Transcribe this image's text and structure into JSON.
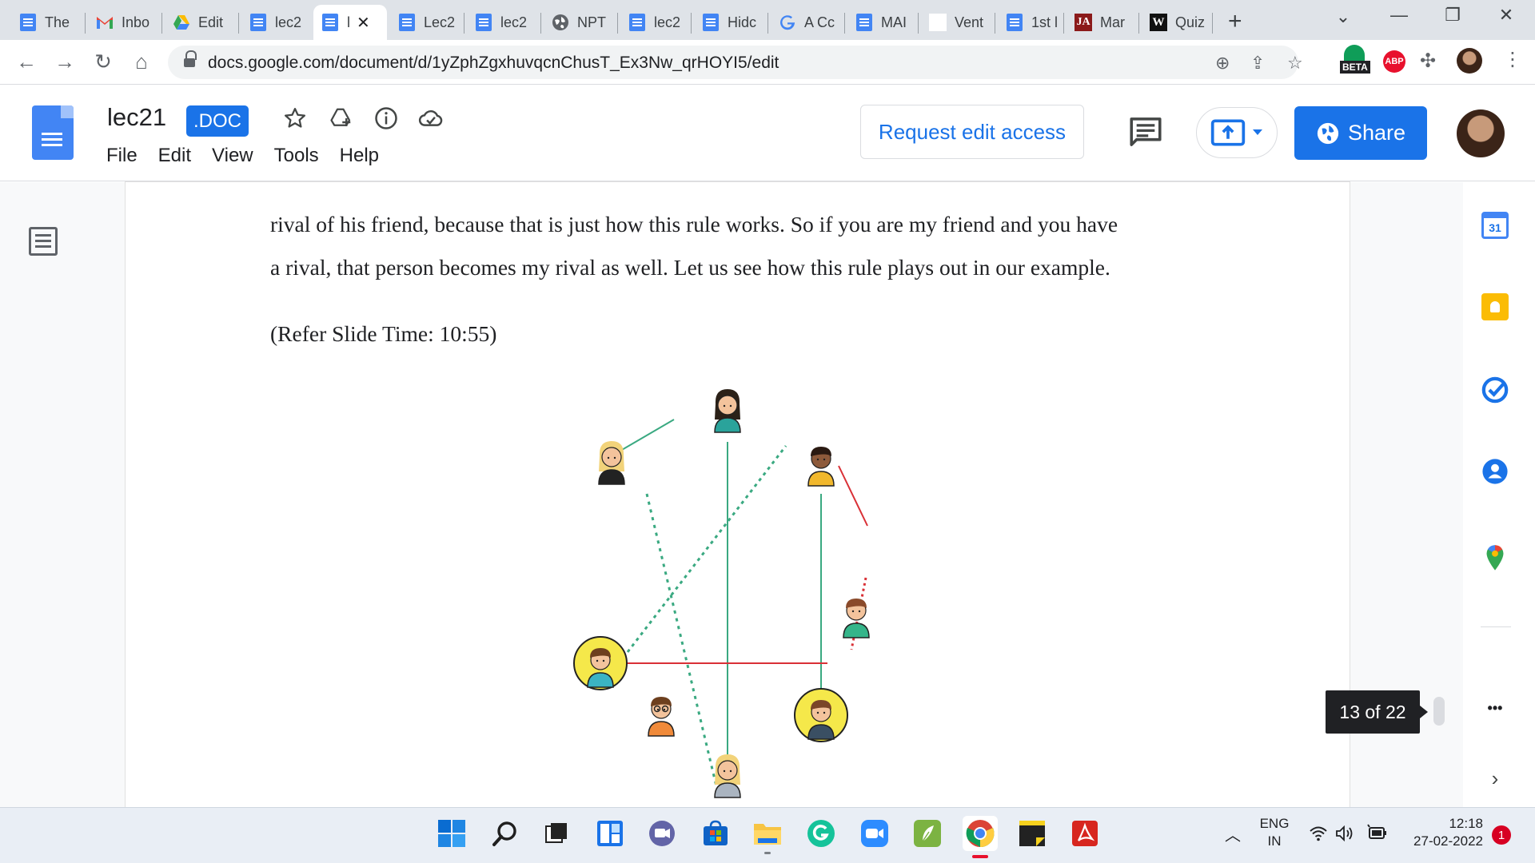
{
  "browser": {
    "tabs": [
      {
        "label": "The",
        "icon": "docs-icon"
      },
      {
        "label": "Inbo",
        "icon": "gmail-icon"
      },
      {
        "label": "Edit",
        "icon": "drive-icon"
      },
      {
        "label": "lec2",
        "icon": "docs-icon"
      },
      {
        "label": "l",
        "icon": "docs-icon",
        "active": true
      },
      {
        "label": "Lec2",
        "icon": "docs-icon"
      },
      {
        "label": "lec2",
        "icon": "docs-icon"
      },
      {
        "label": "NPT",
        "icon": "globe-icon"
      },
      {
        "label": "lec2",
        "icon": "docs-icon"
      },
      {
        "label": "Hidc",
        "icon": "docs-icon"
      },
      {
        "label": "A Cc",
        "icon": "google-icon"
      },
      {
        "label": "MAI",
        "icon": "docs-icon"
      },
      {
        "label": "Vent",
        "icon": "blank-icon"
      },
      {
        "label": "1st l",
        "icon": "docs-icon"
      },
      {
        "label": "Mar",
        "icon": "ja-icon"
      },
      {
        "label": "Quiz",
        "icon": "w-icon"
      }
    ],
    "new_tab_label": "+",
    "url": "docs.google.com/document/d/1yZphZgxhuvqcnChusT_Ex3Nw_qrHOYI5/edit",
    "ext_beta_label": "BETA",
    "ext_abp_label": "ABP"
  },
  "docs": {
    "title": "lec21",
    "badge": ".DOC",
    "menu": [
      "File",
      "Edit",
      "View",
      "Tools",
      "Help"
    ],
    "request_edit_label": "Request edit access",
    "share_label": "Share"
  },
  "document": {
    "line1": "rival of his friend, because that is just how this rule works. So if you are my friend and you have",
    "line2": "a rival, that person becomes my rival as well. Let us see how this rule plays out in our example.",
    "slide_ref": "(Refer Slide Time: 10:55)",
    "page_counter": "13 of 22"
  },
  "side_panel": {
    "calendar_day": "31",
    "more_label": "•••"
  },
  "taskbar": {
    "lang_top": "ENG",
    "lang_bottom": "IN",
    "time": "12:18",
    "date": "27-02-2022",
    "notification_count": "1"
  },
  "colors": {
    "accent": "#1a73e8",
    "friend_edge": "#3aa981",
    "rival_edge": "#d93036",
    "highlight_ring": "#f5e84a"
  }
}
